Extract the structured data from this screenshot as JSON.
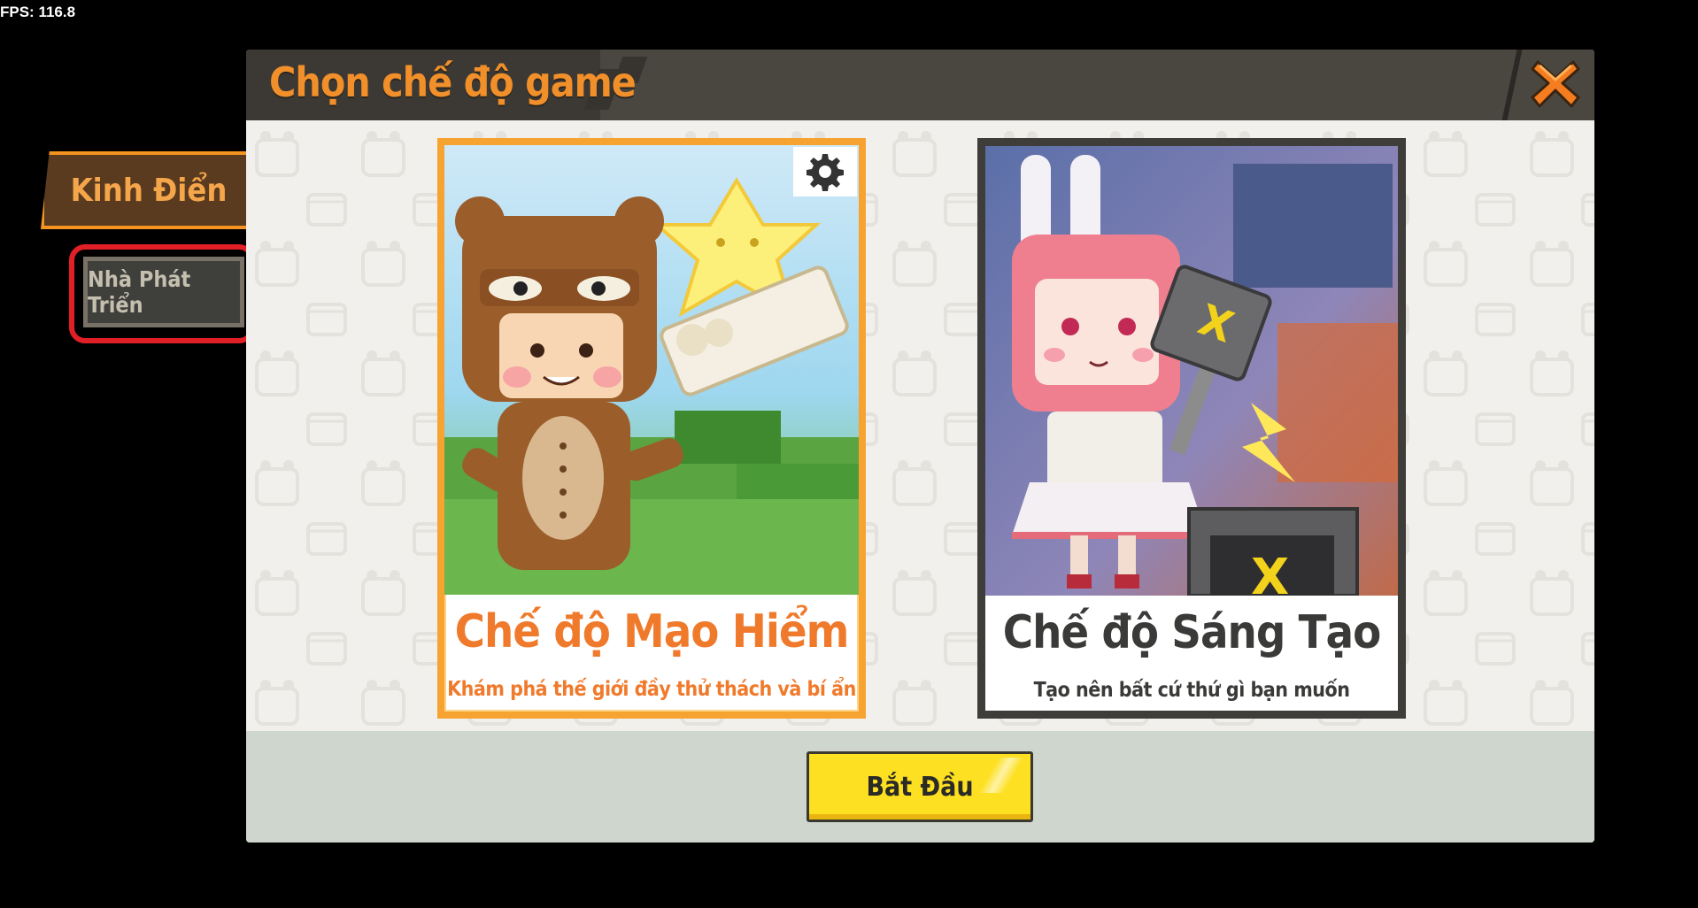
{
  "fps": "FPS: 116.8",
  "dialog": {
    "title": "Chọn chế độ game",
    "close_icon": "close-x-icon"
  },
  "side_tabs": {
    "classic": "Kinh Điển",
    "developer": "Nhà Phát Triển"
  },
  "modes": [
    {
      "title": "Chế độ Mạo Hiểm",
      "subtitle": "Khám phá thế giới đầy thử thách và bí ẩn",
      "selected": true,
      "settings_icon": "gear-icon"
    },
    {
      "title": "Chế độ Sáng Tạo",
      "subtitle": "Tạo nên bất cứ thứ gì bạn muốn",
      "selected": false
    }
  ],
  "start_button": "Bắt Đầu",
  "colors": {
    "accent_orange": "#f18f2a",
    "start_yellow": "#fde021",
    "highlight_red": "#e11f26",
    "header_dark": "#4a4740"
  }
}
